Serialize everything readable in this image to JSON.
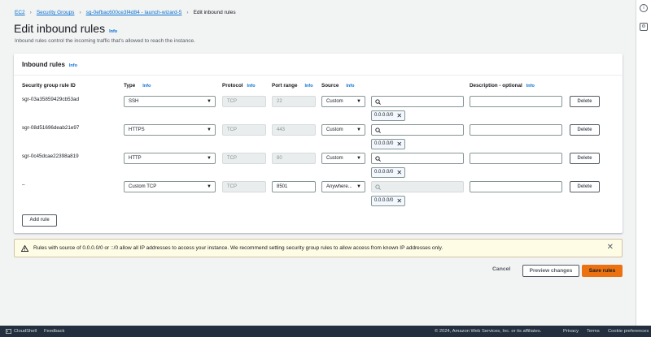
{
  "breadcrumb": [
    "EC2",
    "Security Groups",
    "sg-0efbac600ce3f4d84 - launch-wizard-5",
    "Edit inbound rules"
  ],
  "page": {
    "title": "Edit inbound rules",
    "info": "Info",
    "description": "Inbound rules control the incoming traffic that's allowed to reach the instance."
  },
  "panel": {
    "title": "Inbound rules",
    "info": "Info",
    "columns": {
      "rule_id": "Security group rule ID",
      "type": "Type",
      "protocol": "Protocol",
      "port": "Port range",
      "source": "Source",
      "description": "Description - optional"
    },
    "rules": [
      {
        "id": "sgr-03a35859429cb53ad",
        "type": "SSH",
        "protocol": "TCP",
        "port": "22",
        "source": "Custom",
        "token": "0.0.0.0/0",
        "delete": "Delete"
      },
      {
        "id": "sgr-08d51696deab21e97",
        "type": "HTTPS",
        "protocol": "TCP",
        "port": "443",
        "source": "Custom",
        "token": "0.0.0.0/0",
        "delete": "Delete"
      },
      {
        "id": "sgr-0c45dcae22398a819",
        "type": "HTTP",
        "protocol": "TCP",
        "port": "80",
        "source": "Custom",
        "token": "0.0.0.0/0",
        "delete": "Delete"
      },
      {
        "id": "–",
        "type": "Custom TCP",
        "protocol": "TCP",
        "port": "8501",
        "source": "Anywhere...",
        "token": "0.0.0.0/0",
        "delete": "Delete"
      }
    ],
    "add_rule": "Add rule"
  },
  "warning": {
    "text": "Rules with source of 0.0.0.0/0 or ::/0 allow all IP addresses to access your instance. We recommend setting security group rules to allow access from known IP addresses only."
  },
  "actions": {
    "cancel": "Cancel",
    "preview": "Preview changes",
    "save": "Save rules"
  },
  "footer": {
    "cloudshell": "CloudShell",
    "feedback": "Feedback",
    "copyright": "© 2024, Amazon Web Services, Inc. or its affiliates.",
    "privacy": "Privacy",
    "terms": "Terms",
    "cookies": "Cookie preferences"
  },
  "colors": {
    "link": "#0972d3",
    "primary_button": "#ec7211",
    "warning_bg": "#fffce6",
    "footer_bg": "#232f3e"
  },
  "icons": [
    "info-icon",
    "settings-icon",
    "search-icon",
    "close-icon",
    "warning-icon",
    "cloudshell-icon",
    "chevron-down-icon"
  ]
}
